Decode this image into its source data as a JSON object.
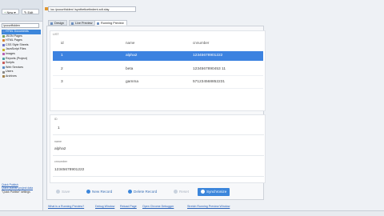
{
  "toolbar": {
    "new_label": "New",
    "edit_label": "Edit"
  },
  "sidebar": {
    "search_value": "/pocuriftolden",
    "tree": [
      {
        "label": "HTML Documents",
        "color": "#5c8fd6",
        "selected": true
      },
      {
        "label": "JSON Pages",
        "color": "#7aa35a",
        "selected": false
      },
      {
        "label": "HTML Pages",
        "color": "#d9822b",
        "selected": false
      },
      {
        "label": "CSS Style Sheets",
        "color": "#6a72c8",
        "selected": false
      },
      {
        "label": "JavaScript Files",
        "color": "#c9b32b",
        "selected": false
      },
      {
        "label": "Images",
        "color": "#b55fb3",
        "selected": false
      },
      {
        "label": "Reports (Project)",
        "color": "#4aa3a3",
        "selected": false
      },
      {
        "label": "Scripts",
        "color": "#c75b5b",
        "selected": false
      },
      {
        "label": "Web Services",
        "color": "#5b8cc7",
        "selected": false
      },
      {
        "label": "Users",
        "color": "#8b8b8b",
        "selected": false
      },
      {
        "label": "Archives",
        "color": "#a3834a",
        "selected": false
      }
    ],
    "quick_title": "Quick Publish",
    "quick_link": "Quick publish project data",
    "quick_note": "\"Quick Publish\" settings"
  },
  "header": {
    "path": "/oc /pocurifolden/ /syntheticetindent.xdt.xlay"
  },
  "tabs": [
    {
      "label": "Design",
      "active": false
    },
    {
      "label": "Live Preview",
      "active": false
    },
    {
      "label": "Running Preview",
      "active": true
    }
  ],
  "list": {
    "title": "LIST",
    "columns": [
      "id",
      "name",
      "cnnumber"
    ],
    "rows": [
      {
        "id": "1",
        "name": "alpha2",
        "cnnumber": "12345678901222",
        "selected": true
      },
      {
        "id": "2",
        "name": "beta",
        "cnnumber": "1234567890453 11",
        "selected": false
      },
      {
        "id": "3",
        "name": "gamma",
        "cnnumber": "571234568852231",
        "selected": false
      }
    ]
  },
  "form": {
    "id_label": "ID",
    "id_value": "1",
    "name_label": "name",
    "name_value": "alpha2",
    "cnnumber_label": "cnnumber",
    "cnnumber_value": "12345678901222"
  },
  "actions": {
    "save": "Save",
    "new_record": "New Record",
    "delete_record": "Delete Record",
    "reset": "Reset",
    "synchronize": "Synchronize"
  },
  "status": {
    "links": [
      "What is a Running Preview?",
      "Debug Window",
      "Reload Page",
      "Open Chrome Debugger",
      "Stretch Running Preview Window"
    ]
  },
  "colors": {
    "accent": "#3c86db",
    "selected_row": "#3c82e0"
  }
}
